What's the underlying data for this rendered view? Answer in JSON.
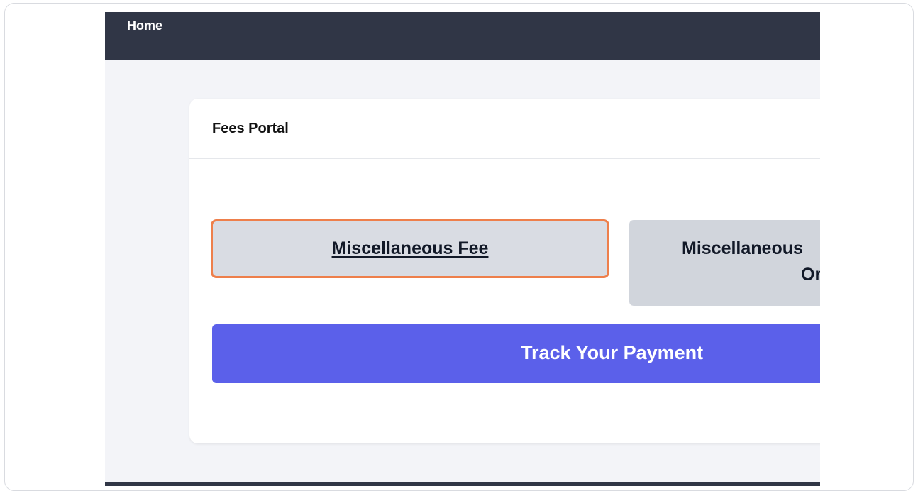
{
  "nav": {
    "home_label": "Home"
  },
  "card": {
    "title": "Fees Portal"
  },
  "buttons": {
    "misc_fee": "Miscellaneous Fee",
    "misc_fee_other_line1": "Miscellaneous",
    "misc_fee_other_line2": "Or",
    "track_payment": "Track Your Payment"
  },
  "colors": {
    "navbar": "#303646",
    "page_background": "#f3f4f8",
    "highlight_border": "#ee7f4b",
    "track_button": "#5b60ea",
    "secondary_button": "#d1d5dc"
  }
}
